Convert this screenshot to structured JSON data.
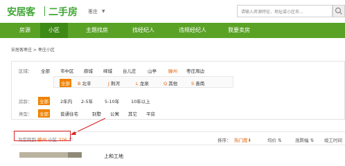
{
  "header": {
    "logo": "安居客",
    "section_title": "二手房",
    "city": "枣庄",
    "search_placeholder": "请输入房源特征、地址或小区名..."
  },
  "nav": {
    "items": [
      {
        "label": "房源",
        "active": false
      },
      {
        "label": "小区",
        "active": true
      },
      {
        "label": "主题找房",
        "active": false
      },
      {
        "label": "找经纪人",
        "active": false
      },
      {
        "label": "违规经纪人",
        "active": false
      },
      {
        "label": "我要卖房",
        "active": false
      }
    ]
  },
  "breadcrumb": "安居客枣庄 > 枣庄小区",
  "filters": {
    "area": {
      "label": "区域：",
      "options": [
        "全部",
        "市中区",
        "薛城",
        "峄城",
        "台儿庄",
        "山亭",
        "滕州",
        "枣庄周边"
      ],
      "selected": "滕州"
    },
    "subarea": {
      "options": [
        {
          "letter": "",
          "name": "全部"
        },
        {
          "letter": "B",
          "name": "北辛"
        },
        {
          "letter": "J",
          "name": "荆河"
        },
        {
          "letter": "L",
          "name": "龙泉"
        },
        {
          "letter": "Q",
          "name": "其他"
        },
        {
          "letter": "S",
          "name": "善南"
        }
      ],
      "selected": "全部"
    },
    "age": {
      "label": "房龄：",
      "options": [
        "全部",
        "2年内",
        "2-5年",
        "5-10年",
        "10年以上"
      ],
      "selected": "全部"
    },
    "type": {
      "label": "类型：",
      "options": [
        "全部",
        "普通住宅",
        "别墅",
        "公寓",
        "其它",
        "平房"
      ],
      "selected": "全部"
    }
  },
  "result": {
    "prefix": "为您找到",
    "city": "滕州",
    "middle": "小区",
    "count": "326",
    "suffix": "个"
  },
  "sort": {
    "label": "排序：",
    "options": [
      "热门度",
      "均价",
      "涨跌幅",
      "竣工时间"
    ]
  },
  "listing": {
    "title": "上和工地"
  },
  "colors": {
    "brand_green": "#3fa535",
    "nav_green": "#5aa226",
    "nav_active": "#3e8a16",
    "accent_orange": "#f08200",
    "annotation_red": "#d9232a"
  }
}
